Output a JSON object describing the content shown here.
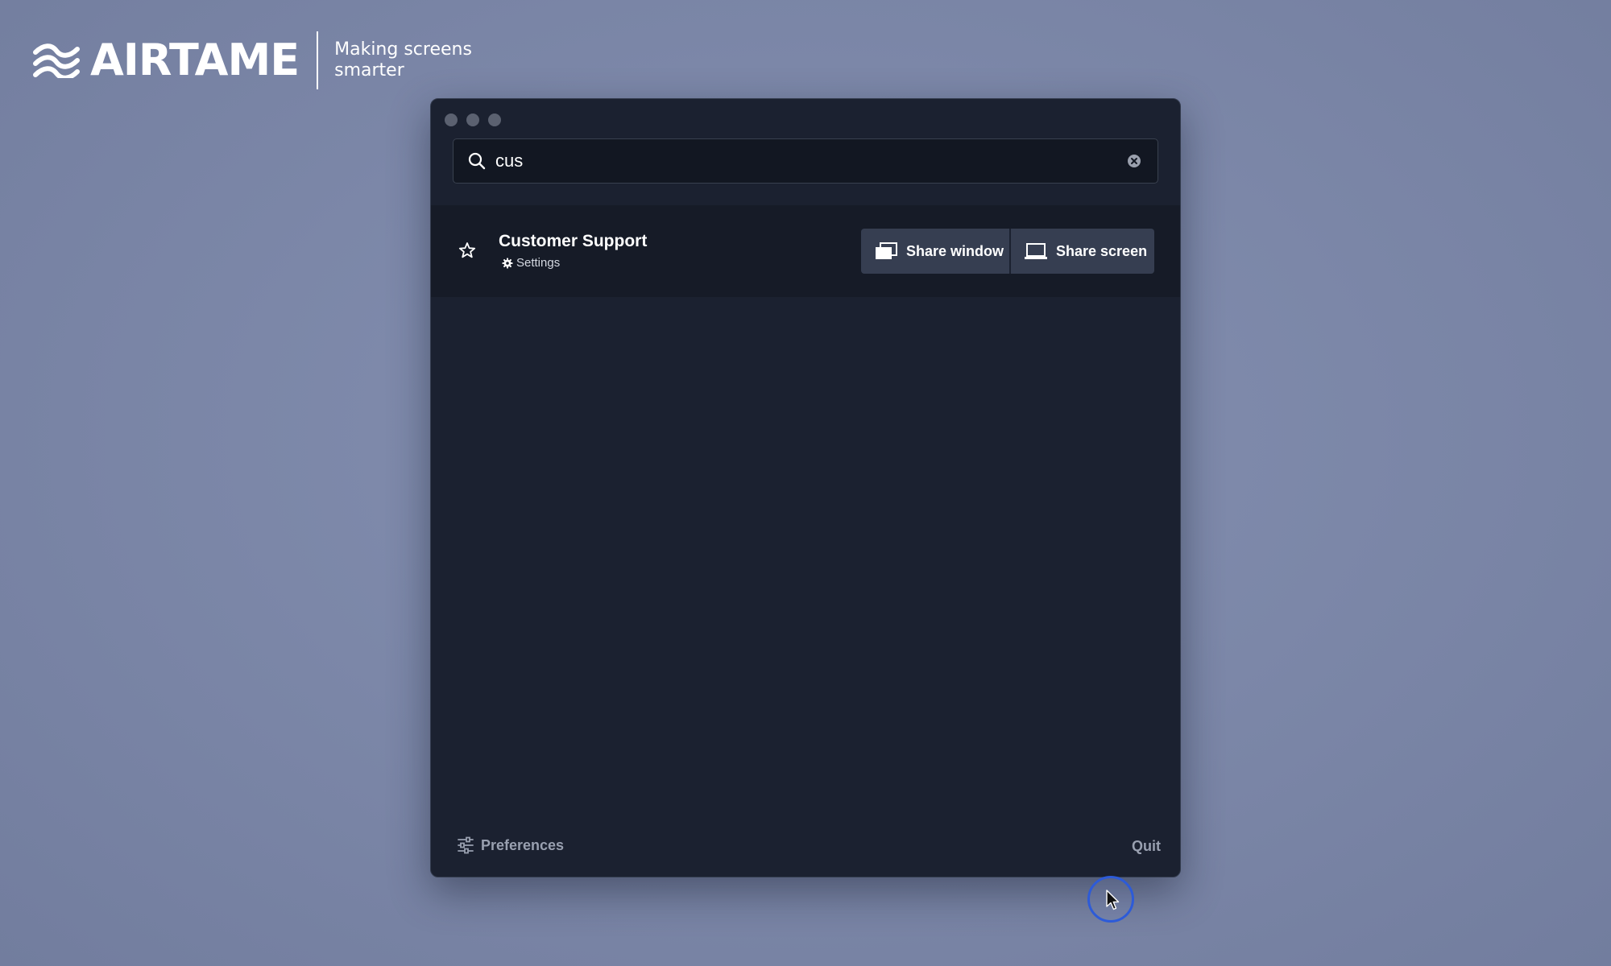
{
  "brand": {
    "wordmark": "AIRTAME",
    "tagline": "Making screens\nsmarter"
  },
  "search": {
    "value": "cus",
    "placeholder": ""
  },
  "result": {
    "title": "Customer Support",
    "subtitle": "Settings",
    "share_window_label": "Share window",
    "share_screen_label": "Share screen"
  },
  "footer": {
    "preferences_label": "Preferences",
    "quit_label": "Quit"
  },
  "icons": {
    "search": "search-icon",
    "clear": "clear-icon",
    "favorite": "star-icon",
    "settings": "gear-icon",
    "share_window": "window-icon",
    "share_screen": "monitor-icon",
    "preferences": "sliders-icon",
    "cursor": "cursor-icon"
  },
  "colors": {
    "desktop": "#7c87a8",
    "window_background": "#1b2130",
    "row_background": "#161b27",
    "button_background": "#363e51",
    "muted_text": "#99a0b0",
    "cursor_ring": "#2d5bd8"
  }
}
